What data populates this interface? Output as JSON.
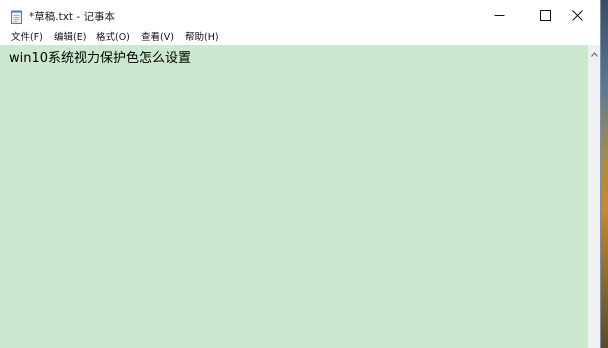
{
  "window": {
    "title": "*草稿.txt - 记事本",
    "icon": "notepad-icon"
  },
  "caption_buttons": {
    "minimize": "minimize-icon",
    "maximize": "maximize-icon",
    "close": "close-icon"
  },
  "menu": {
    "items": [
      {
        "label": "文件(F)"
      },
      {
        "label": "编辑(E)"
      },
      {
        "label": "格式(O)"
      },
      {
        "label": "查看(V)"
      },
      {
        "label": "帮助(H)"
      }
    ]
  },
  "editor": {
    "content": "win10系统视力保护色怎么设置",
    "background_color": "#cce8cf"
  },
  "scrollbar": {
    "up_arrow": "chevron-up-icon"
  }
}
